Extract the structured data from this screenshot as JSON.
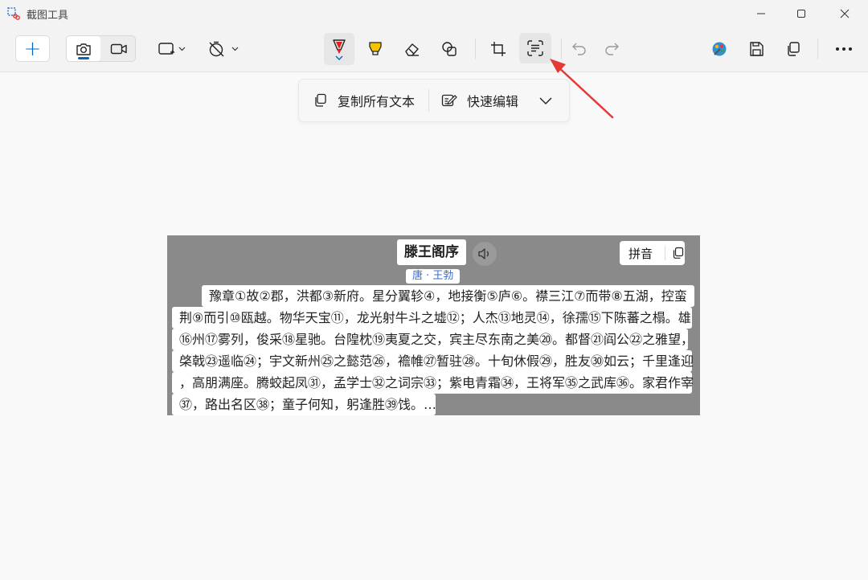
{
  "window": {
    "title": "截图工具"
  },
  "toolbar": {
    "new_label": "+"
  },
  "ocr_actions": {
    "copy_all_label": "复制所有文本",
    "quick_edit_label": "快速编辑"
  },
  "ocr_result": {
    "title": "滕王阁序",
    "author": "唐 · 王勃",
    "pinyin_label": "拼音",
    "lines": [
      "豫章①故②郡，洪都③新府。星分翼轸④，地接衡⑤庐⑥。襟三江⑦而带⑧五湖，控蛮",
      "荆⑨而引⑩瓯越。物华天宝⑪，龙光射牛斗之墟⑫；人杰⑬地灵⑭，徐孺⑮下陈蕃之榻。雄",
      "⑯州⑰雾列，俊采⑱星驰。台隍枕⑲夷夏之交，宾主尽东南之美⑳。都督㉑阎公㉒之雅望，",
      "棨戟㉓遥临㉔；宇文新州㉕之懿范㉖，襜帷㉗暂驻㉘。十旬休假㉙，胜友㉚如云；千里逢迎",
      "，高朋满座。腾蛟起凤㉛，孟学士㉜之词宗㉝；紫电青霜㉞，王将军㉟之武库㊱。家君作宰",
      "㊲，路出名区㊳；童子何知，躬逢胜㊴饯。…"
    ]
  },
  "colors": {
    "accent": "#0067c0",
    "pen_red": "#e02020",
    "highlighter_yellow": "#f5c400",
    "annotation_arrow": "#e53935"
  }
}
